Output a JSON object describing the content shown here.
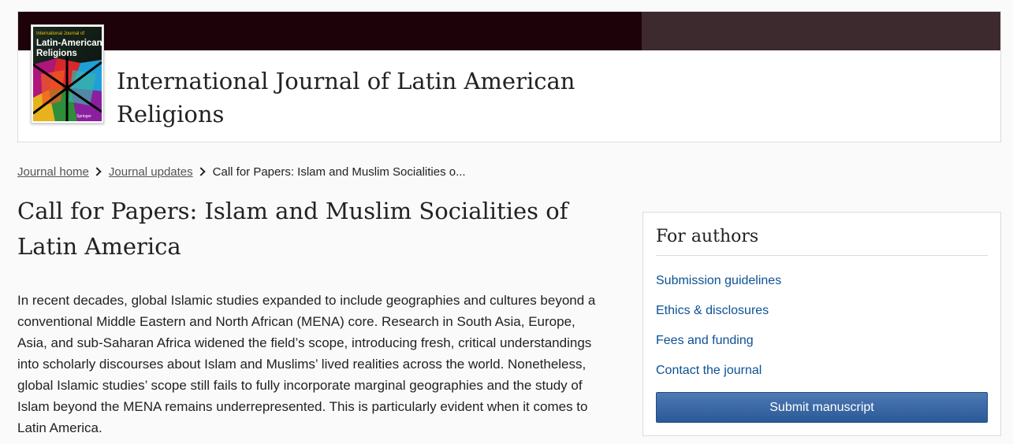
{
  "header": {
    "cover_text_top": "International Journal of",
    "cover_text_main_1": "Latin-American",
    "cover_text_main_2": "Religions",
    "cover_publisher": "Springer",
    "journal_title": "International Journal of Latin American Religions"
  },
  "breadcrumb": {
    "items": [
      {
        "label": "Journal home"
      },
      {
        "label": "Journal updates"
      },
      {
        "label": "Call for Papers: Islam and Muslim Socialities o..."
      }
    ]
  },
  "article": {
    "title": "Call for Papers: Islam and Muslim Socialities of Latin America",
    "body": "In recent decades, global Islamic studies expanded to include geographies and cultures beyond a conventional Middle Eastern and North African (MENA) core. Research in South Asia, Europe, Asia, and sub-Saharan Africa widened the field’s scope, introducing fresh, critical understandings into scholarly discourses about Islam and Muslims’ lived realities across the world. Nonetheless, global Islamic studies’ scope still fails to fully incorporate marginal geographies and the study of Islam beyond the MENA remains underrepresented. This is particularly evident when it comes to Latin America."
  },
  "sidebar": {
    "heading": "For authors",
    "links": [
      {
        "label": "Submission guidelines"
      },
      {
        "label": "Ethics & disclosures"
      },
      {
        "label": "Fees and funding"
      },
      {
        "label": "Contact the journal"
      }
    ],
    "submit_label": "Submit manuscript"
  },
  "colors": {
    "masthead_dark": "#1e0209",
    "masthead_light": "#3c2a2f",
    "link": "#0c5194",
    "button": "#2b5a96"
  }
}
